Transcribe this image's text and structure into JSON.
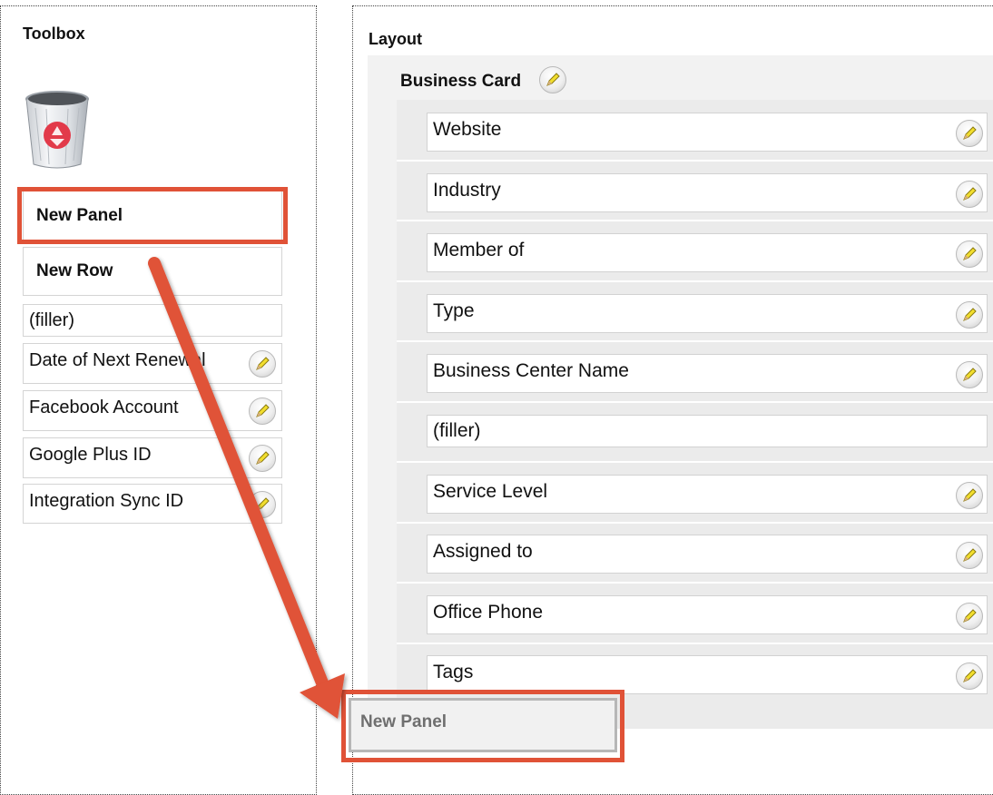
{
  "toolbox": {
    "title": "Toolbox",
    "trash_icon": "recycle-bin-icon",
    "items": [
      {
        "label": "New Panel",
        "bold": true
      },
      {
        "label": "New Row",
        "bold": true
      },
      {
        "label": "(filler)",
        "editable": false
      },
      {
        "label": "Date of Next Renewal",
        "editable": true
      },
      {
        "label": "Facebook Account",
        "editable": true
      },
      {
        "label": "Google Plus ID",
        "editable": true
      },
      {
        "label": "Integration Sync ID",
        "editable": true
      }
    ]
  },
  "layout": {
    "title": "Layout",
    "panel": {
      "title": "Business Card",
      "fields": [
        {
          "label": "Website",
          "editable": true
        },
        {
          "label": "Industry",
          "editable": true
        },
        {
          "label": "Member of",
          "editable": true
        },
        {
          "label": "Type",
          "editable": true
        },
        {
          "label": "Business Center Name",
          "editable": true
        },
        {
          "label": "(filler)",
          "editable": false
        },
        {
          "label": "Service Level",
          "editable": true
        },
        {
          "label": "Assigned to",
          "editable": true
        },
        {
          "label": "Office Phone",
          "editable": true
        },
        {
          "label": "Tags",
          "editable": true
        }
      ]
    },
    "drop_target_label": "New Panel"
  },
  "colors": {
    "annotation_red": "#e05237",
    "pencil_yellow": "#f2de2e"
  },
  "icons": {
    "edit": "pencil-icon",
    "annotation_arrow": "drag-arrow"
  }
}
